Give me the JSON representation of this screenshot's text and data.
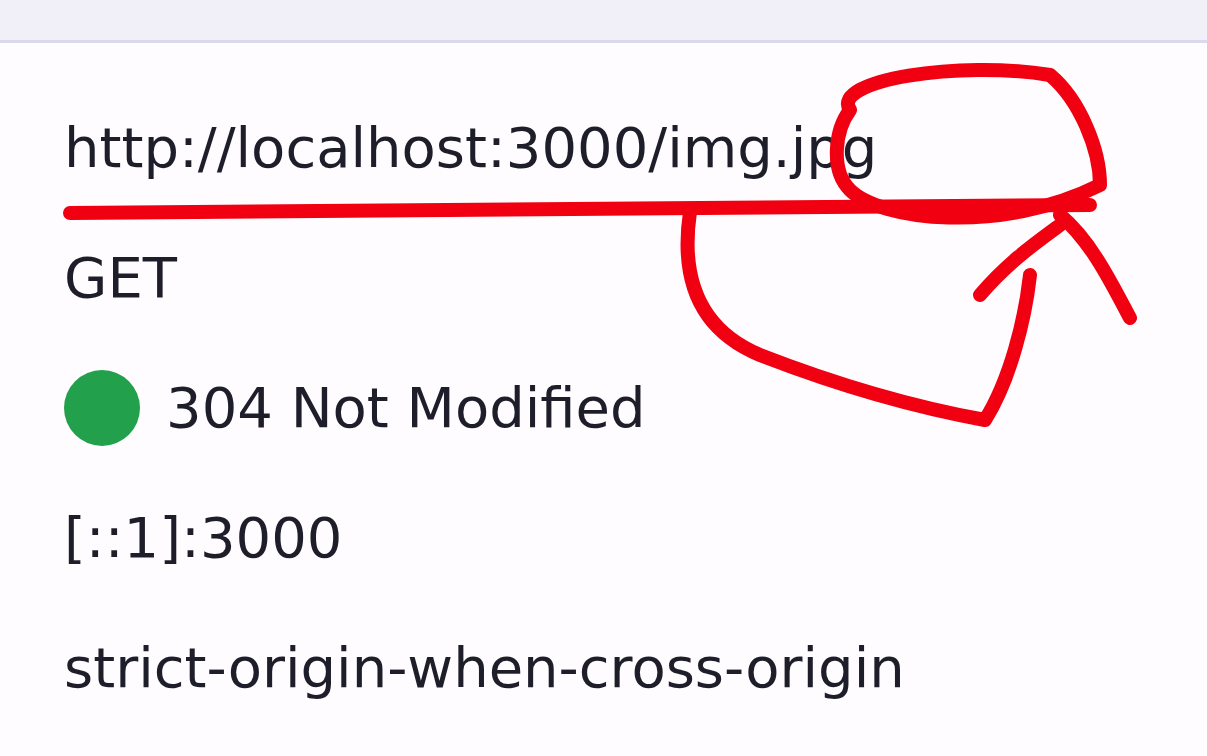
{
  "request": {
    "url": "http://localhost:3000/img.jpg",
    "method": "GET",
    "status": {
      "text": "304 Not Modified",
      "color": "#22a04b"
    },
    "remote_address": "[::1]:3000",
    "referrer_policy": "strict-origin-when-cross-origin"
  }
}
